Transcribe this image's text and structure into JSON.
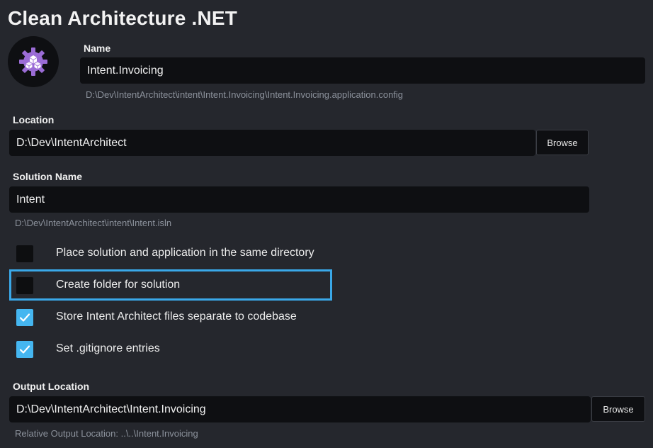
{
  "header": {
    "title": "Clean Architecture .NET"
  },
  "icons": {
    "logo": "gear-with-cubes-icon",
    "check": "check-icon"
  },
  "name": {
    "label": "Name",
    "value": "Intent.Invoicing",
    "path_hint": "D:\\Dev\\IntentArchitect\\intent\\Intent.Invoicing\\Intent.Invoicing.application.config"
  },
  "location": {
    "label": "Location",
    "value": "D:\\Dev\\IntentArchitect",
    "browse_label": "Browse"
  },
  "solution": {
    "label": "Solution Name",
    "value": "Intent",
    "path_hint": "D:\\Dev\\IntentArchitect\\intent\\Intent.isln"
  },
  "options": [
    {
      "label": "Place solution and application in the same directory",
      "checked": false
    },
    {
      "label": "Create folder for solution",
      "checked": false
    },
    {
      "label": "Store Intent Architect files separate to codebase",
      "checked": true
    },
    {
      "label": "Set .gitignore entries",
      "checked": true
    }
  ],
  "output": {
    "label": "Output Location",
    "value": "D:\\Dev\\IntentArchitect\\Intent.Invoicing",
    "browse_label": "Browse",
    "relative_hint": "Relative Output Location: ..\\..\\Intent.Invoicing"
  },
  "colors": {
    "background": "#25272d",
    "input_background": "#0e0f12",
    "accent": "#45b6f0",
    "focus_outline": "#3aa8e8",
    "logo": "#9b6cd6"
  }
}
